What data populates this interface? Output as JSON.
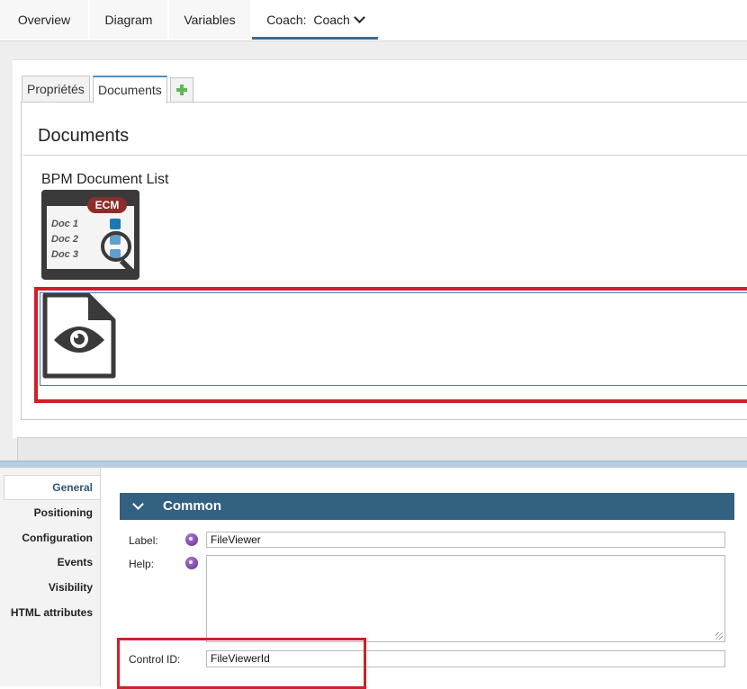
{
  "top_tabs": {
    "overview": "Overview",
    "diagram": "Diagram",
    "variables": "Variables",
    "coach_prefix": "Coach:",
    "coach_value": "Coach"
  },
  "inner_tabs": {
    "proprietes": "Propriétés",
    "documents": "Documents"
  },
  "canvas": {
    "section_title": "Documents",
    "bpm_label": "BPM Document List",
    "ecm_badge": "ECM",
    "docs": [
      "Doc 1",
      "Doc 2",
      "Doc 3"
    ]
  },
  "sidebar": {
    "items": [
      "General",
      "Positioning",
      "Configuration",
      "Events",
      "Visibility",
      "HTML attributes"
    ]
  },
  "common": {
    "title": "Common",
    "label_label": "Label:",
    "label_value": "FileViewer",
    "help_label": "Help:",
    "help_value": "",
    "control_id_label": "Control ID:",
    "control_id_value": "FileViewerId"
  },
  "colors": {
    "accent": "#336182",
    "highlight": "#d01f2a"
  }
}
